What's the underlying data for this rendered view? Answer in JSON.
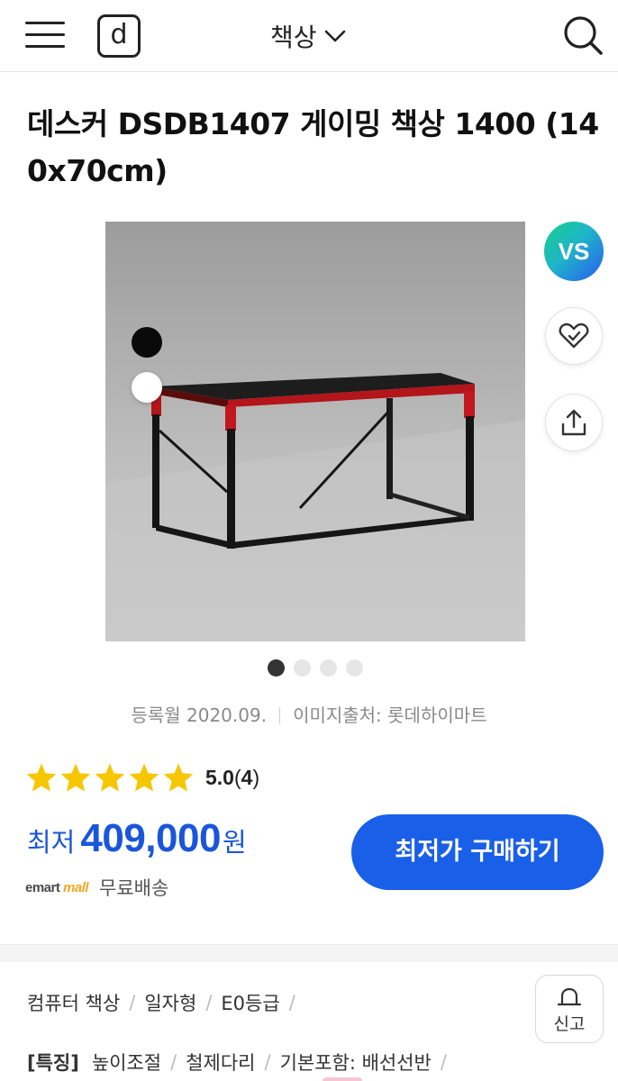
{
  "header": {
    "logo_letter": "d",
    "category": "책상"
  },
  "product": {
    "title": "데스커 DSDB1407 게이밍 책상 1400 (140x70cm)",
    "vs_badge": "VS",
    "image_count": 4,
    "active_image": 1,
    "color_options": [
      "black",
      "white"
    ],
    "registered": "등록월 2020.09.",
    "image_source": "이미지출처: 롯데하이마트"
  },
  "rating": {
    "score": "5.0",
    "count": "4",
    "stars": 5
  },
  "price": {
    "prefix": "최저",
    "value": "409,000",
    "unit": "원",
    "shop_logo_a": "emart",
    "shop_logo_b": "mall",
    "shipping": "무료배송",
    "buy_label": "최저가 구매하기"
  },
  "specs": {
    "breadcrumb": [
      "컴퓨터 책상",
      "일자형",
      "E0등급"
    ],
    "feature_tag": "[특징]",
    "features": [
      "높이조절",
      "철제다리",
      "기본포함: 배선선반"
    ]
  },
  "report": {
    "label": "신고"
  },
  "colors": {
    "accent_blue": "#1a5fe8",
    "price_blue": "#1a56db",
    "star_yellow": "#f6c700"
  }
}
